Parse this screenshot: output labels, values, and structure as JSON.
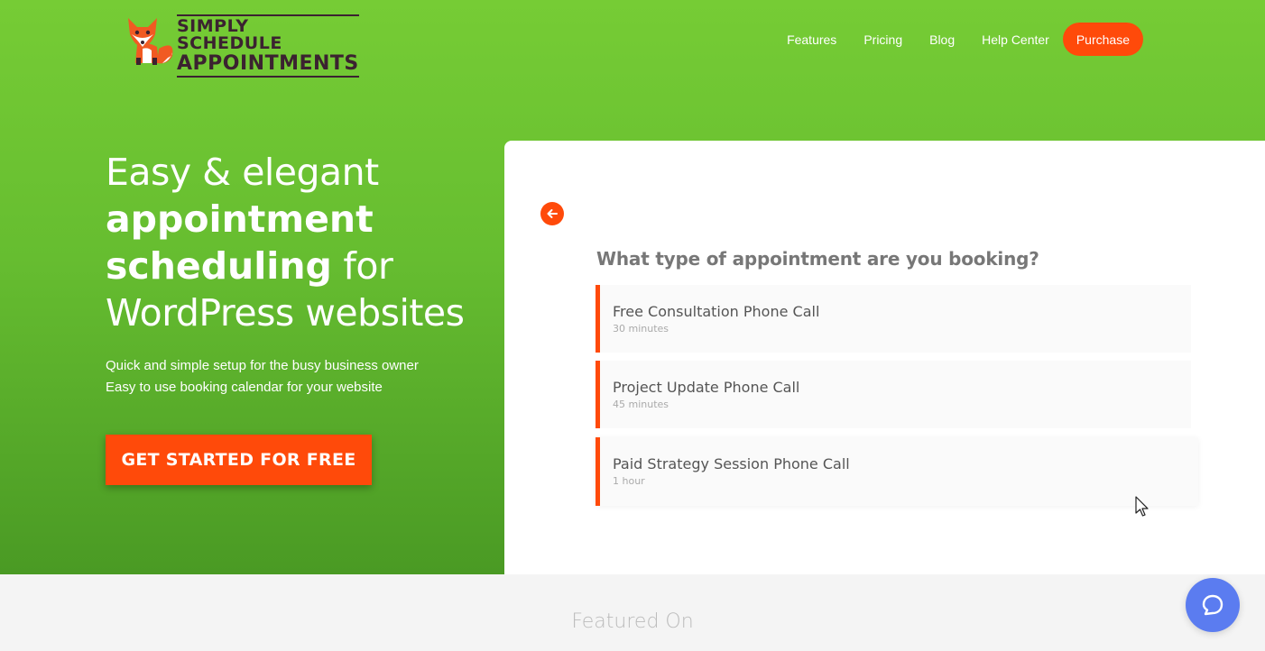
{
  "brand": {
    "logo_line1": "SIMPLY SCHEDULE",
    "logo_line2": "APPOINTMENTS",
    "colors": {
      "accent": "#ff4a0a",
      "hero_green": "#6cc332",
      "chat_blue": "#5b7cf0"
    }
  },
  "nav": {
    "items": [
      {
        "label": "Features"
      },
      {
        "label": "Pricing"
      },
      {
        "label": "Blog"
      },
      {
        "label": "Help Center"
      }
    ],
    "purchase_label": "Purchase"
  },
  "hero": {
    "headline_part1": "Easy & elegant",
    "headline_bold1": "appointment",
    "headline_bold2": "scheduling",
    "headline_part2": " for",
    "headline_part3": "WordPress websites",
    "subline1": "Quick and simple setup for the busy business owner",
    "subline2": "Easy to use booking calendar for your website",
    "cta_label": "GET STARTED FOR FREE"
  },
  "booking": {
    "back_icon": "arrow-left-icon",
    "question": "What type of appointment are you booking?",
    "appointments": [
      {
        "title": "Free Consultation Phone Call",
        "duration": "30 minutes"
      },
      {
        "title": "Project Update Phone Call",
        "duration": "45 minutes"
      },
      {
        "title": "Paid Strategy Session Phone Call",
        "duration": "1 hour"
      }
    ]
  },
  "featured": {
    "heading": "Featured On"
  },
  "chat": {
    "icon": "chat-bubble-icon"
  }
}
